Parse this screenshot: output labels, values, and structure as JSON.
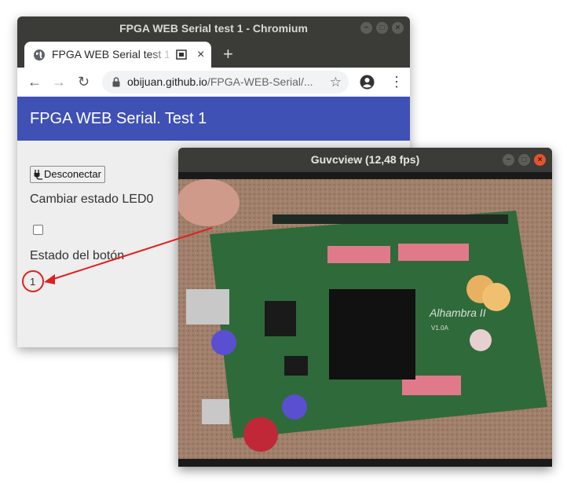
{
  "browser": {
    "window_title": "FPGA WEB Serial test 1 - Chromium",
    "tab": {
      "title": "FPGA WEB Serial test 1",
      "close": "×",
      "favicon": "globe-icon"
    },
    "new_tab": "+",
    "toolbar": {
      "back": "←",
      "forward": "→",
      "reload": "↻",
      "url_host": "obijuan.github.io",
      "url_path": "/FPGA-WEB-Serial/...",
      "bookmark": "☆",
      "menu": "⋮"
    },
    "controls": {
      "minimize": "−",
      "maximize": "□",
      "close": "×"
    }
  },
  "page": {
    "header_title": "FPGA WEB Serial. Test 1",
    "disconnect_button": "Desconectar",
    "led_label": "Cambiar estado LED0",
    "led_checked": false,
    "button_state_label": "Estado del botón",
    "button_state_value": "1"
  },
  "camera_window": {
    "title": "Guvcview  (12,48 fps)",
    "board_label": "Alhambra II",
    "board_version": "V1.0A",
    "controls": {
      "minimize": "−",
      "maximize": "□",
      "close": "×"
    }
  },
  "colors": {
    "app_header": "#3f51b5",
    "annotation": "#e02020",
    "titlebar": "#3b3b38",
    "board": "#2f6a3a"
  }
}
